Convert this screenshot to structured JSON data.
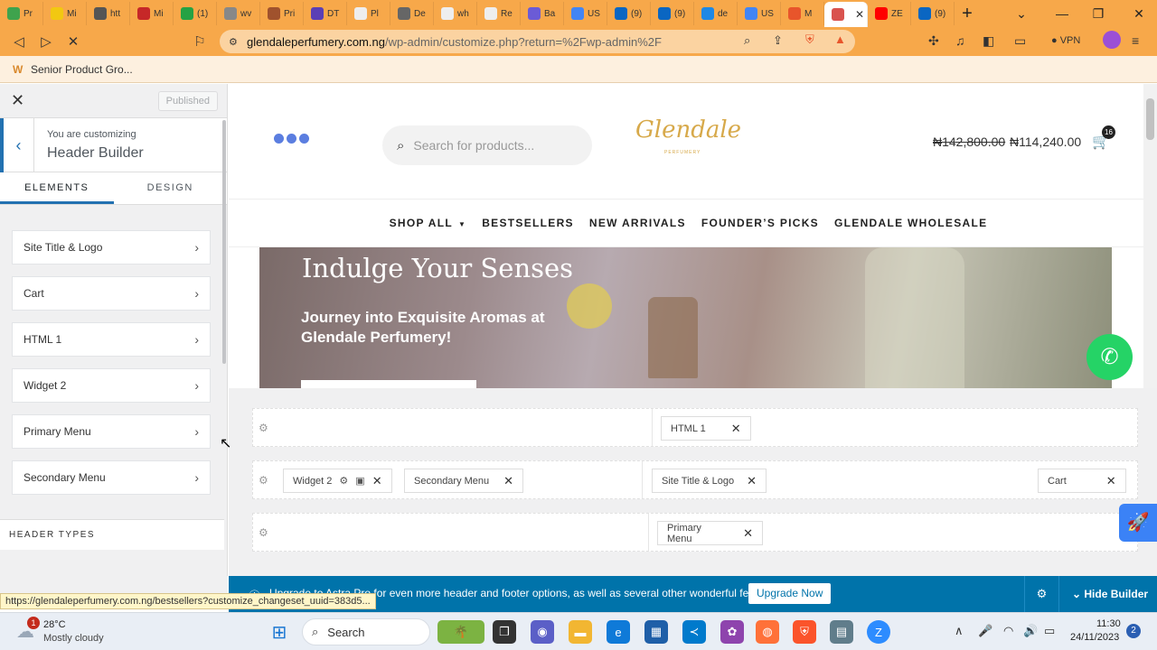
{
  "browser": {
    "tabs": [
      {
        "label": "Pr",
        "color": "#3fa34d"
      },
      {
        "label": "Mi",
        "color": "#f2c811"
      },
      {
        "label": "htt",
        "color": "#555555"
      },
      {
        "label": "Mi",
        "color": "#c62828"
      },
      {
        "label": "(1)",
        "color": "#25a244"
      },
      {
        "label": "wv",
        "color": "#888888"
      },
      {
        "label": "Pri",
        "color": "#a0522d"
      },
      {
        "label": "DT",
        "color": "#5b3fb5"
      },
      {
        "label": "Pl",
        "color": "#eeeeee"
      },
      {
        "label": "De",
        "color": "#666666"
      },
      {
        "label": "wh",
        "color": "#eeeeee"
      },
      {
        "label": "Re",
        "color": "#eeeeee"
      },
      {
        "label": "Ba",
        "color": "#6b5bd6"
      },
      {
        "label": "US",
        "color": "#4285f4"
      },
      {
        "label": "(9)",
        "color": "#0a66c2"
      },
      {
        "label": "(9)",
        "color": "#0a66c2"
      },
      {
        "label": "de",
        "color": "#1e88e5"
      },
      {
        "label": "US",
        "color": "#4285f4"
      },
      {
        "label": "M",
        "color": "#e8552b"
      },
      {
        "label": "",
        "color": "#d9534f"
      },
      {
        "label": "ZE",
        "color": "#ff0000"
      },
      {
        "label": "(9)",
        "color": "#0a66c2"
      }
    ],
    "new_tab": "+",
    "url_host": "glendaleperfumery.com.ng",
    "url_path": "/wp-admin/customize.php?return=%2Fwp-admin%2F",
    "vpn_label": "VPN",
    "bookmark": "Senior Product Gro...",
    "status_url": "https://glendaleperfumery.com.ng/bestsellers?customize_changeset_uuid=383d5..."
  },
  "sidebar": {
    "published_label": "Published",
    "customizing_label": "You are customizing",
    "customizing_title": "Header Builder",
    "tabs": [
      "ELEMENTS",
      "DESIGN"
    ],
    "items": [
      {
        "label": "Site Title & Logo"
      },
      {
        "label": "Cart"
      },
      {
        "label": "HTML 1"
      },
      {
        "label": "Widget 2"
      },
      {
        "label": "Primary Menu"
      },
      {
        "label": "Secondary Menu"
      }
    ],
    "header_types": "HEADER TYPES"
  },
  "site": {
    "search_placeholder": "Search for products...",
    "logo": "Glendale",
    "logo_sub": "PERFUMERY",
    "price_old": "₦142,800.00",
    "price_new": "₦114,240.00",
    "cart_count": "16",
    "nav": [
      "SHOP ALL",
      "BESTSELLERS",
      "NEW ARRIVALS",
      "FOUNDER’S PICKS",
      "GLENDALE WHOLESALE"
    ],
    "hero_title": "Indulge Your Senses",
    "hero_subtitle": "Journey into Exquisite Aromas at Glendale Perfumery!"
  },
  "builder": {
    "row1": {
      "center": "HTML 1"
    },
    "row2": {
      "left": [
        "Widget 2",
        "Secondary Menu"
      ],
      "center": "Site Title & Logo",
      "right": "Cart"
    },
    "row3": {
      "center": "Primary Menu"
    }
  },
  "upgrade": {
    "text": "Upgrade to Astra Pro for even more header and footer options, as well as several other wonderful features!",
    "button": "Upgrade Now",
    "hide_builder": "Hide Builder"
  },
  "taskbar": {
    "weather_badge": "1",
    "temperature": "28°C",
    "weather": "Mostly cloudy",
    "search_label": "Search",
    "time": "11:30",
    "date": "24/11/2023",
    "notifications": "2"
  }
}
